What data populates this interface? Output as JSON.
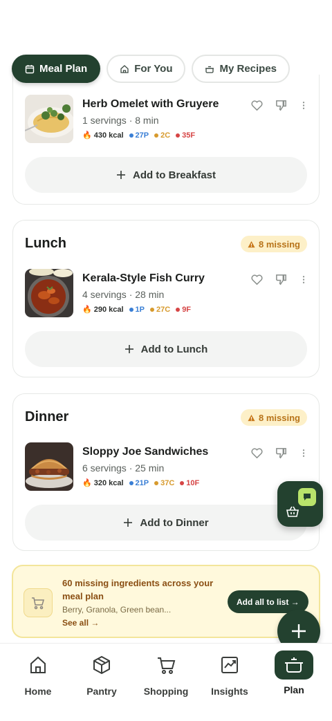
{
  "tabs": [
    {
      "label": "Meal Plan",
      "active": true
    },
    {
      "label": "For You",
      "active": false
    },
    {
      "label": "My Recipes",
      "active": false
    }
  ],
  "breakfast": {
    "recipe": {
      "name": "Herb Omelet with Gruyere",
      "meta": "1 servings · 8 min",
      "kcal": "430 kcal",
      "protein": "27P",
      "carbs": "2C",
      "fat": "35F"
    },
    "add_label": "Add to Breakfast"
  },
  "lunch": {
    "title": "Lunch",
    "missing": "8 missing",
    "recipe": {
      "name": "Kerala-Style Fish Curry",
      "meta": "4 servings · 28 min",
      "kcal": "290 kcal",
      "protein": "1P",
      "carbs": "27C",
      "fat": "9F"
    },
    "add_label": "Add to Lunch"
  },
  "dinner": {
    "title": "Dinner",
    "missing": "8 missing",
    "recipe": {
      "name": "Sloppy Joe Sandwiches",
      "meta": "6 servings · 25 min",
      "kcal": "320 kcal",
      "protein": "21P",
      "carbs": "37C",
      "fat": "10F"
    },
    "add_label": "Add to Dinner"
  },
  "banner": {
    "title": "60 missing ingredients across your meal plan",
    "items": "Berry, Granola, Green bean...",
    "link": "See all →",
    "button": "Add all to list →"
  },
  "nav": [
    {
      "label": "Home",
      "icon": "home-icon"
    },
    {
      "label": "Pantry",
      "icon": "box-icon"
    },
    {
      "label": "Shopping",
      "icon": "cart-icon"
    },
    {
      "label": "Insights",
      "icon": "chart-icon"
    },
    {
      "label": "Plan",
      "icon": "pot-icon",
      "active": true
    }
  ],
  "colors": {
    "primary": "#23412f",
    "accent": "#b9e36b",
    "warning_bg": "#fdf0c8",
    "warning_text": "#b8741a",
    "protein": "#3a7fd5",
    "carbs": "#d79a2d",
    "fat": "#d64545"
  }
}
